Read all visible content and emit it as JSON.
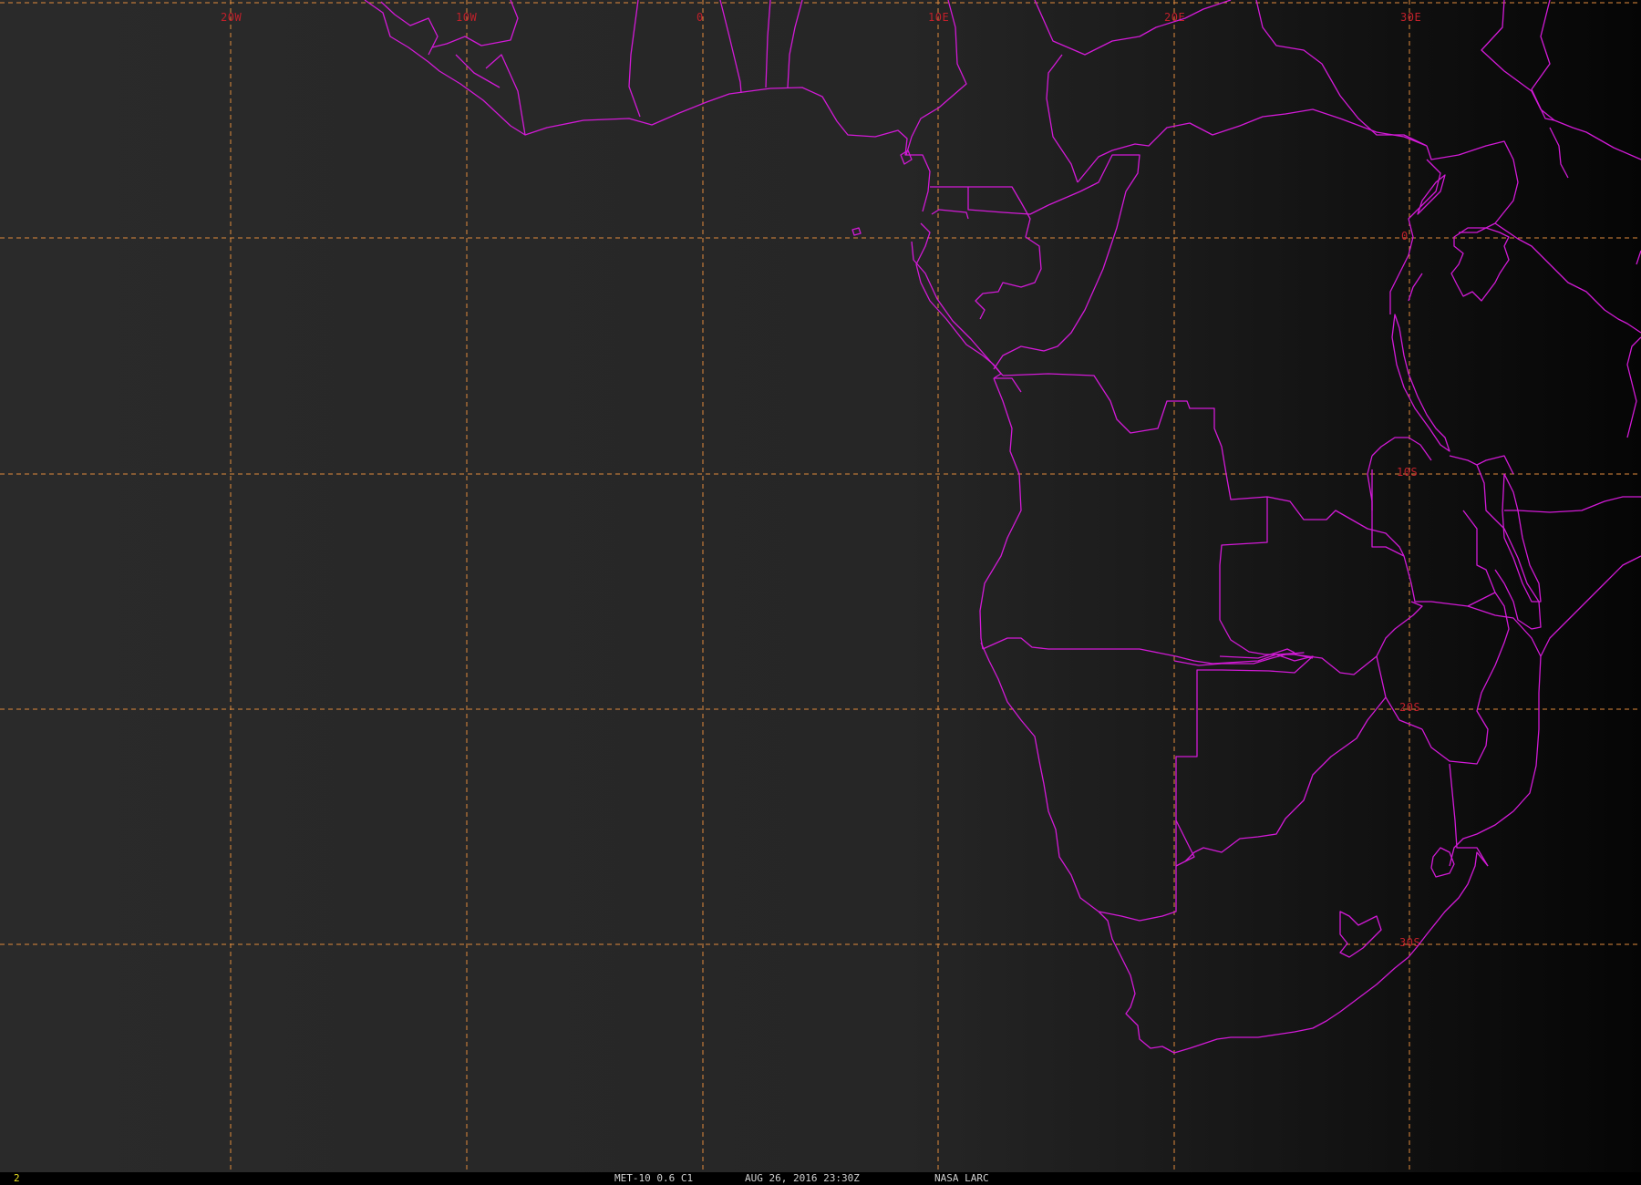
{
  "map": {
    "longitude_labels": [
      "20W",
      "10W",
      "0",
      "10E",
      "20E",
      "30E"
    ],
    "latitude_labels": [
      "0",
      "10S",
      "20S",
      "30S"
    ]
  },
  "status": {
    "frame": "2",
    "satellite": "MET-10 0.6 C1",
    "timestamp": "AUG 26, 2016 23:30Z",
    "organization": "NASA LARC"
  },
  "colors": {
    "background": "#1c1c1c",
    "borders": "#d21ad6",
    "grid": "#e08a3c",
    "grid_labels": "#c0202a",
    "frame_number": "#e8e020"
  }
}
